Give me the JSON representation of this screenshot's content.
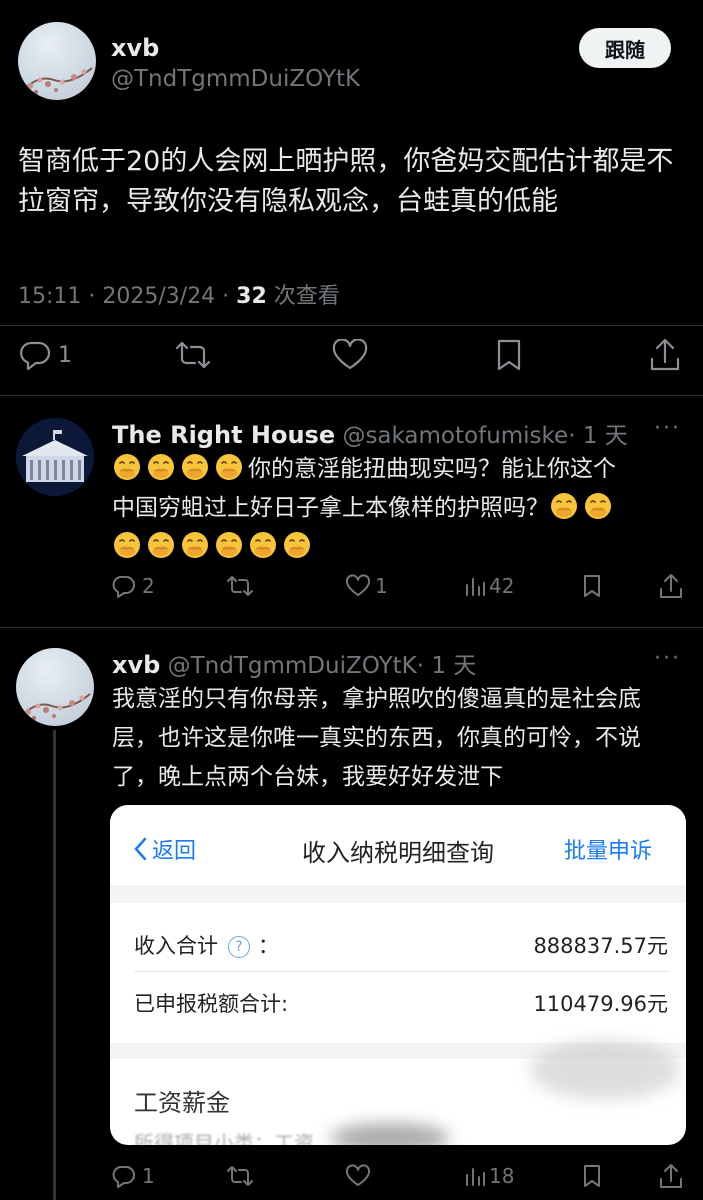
{
  "main_post": {
    "author_name": "xvb",
    "author_handle": "@TndTgmmDuiZOYtK",
    "follow_label": "跟随",
    "text": "智商低于20的人会网上晒护照，你爸妈交配估计都是不拉窗帘，导致你没有隐私观念，台蛙真的低能",
    "time_date": "15:11 · 2025/3/24 · ",
    "views_count": "32",
    "views_label": " 次查看",
    "reply_count": "1"
  },
  "replies": [
    {
      "author_name": "The Right House",
      "author_handle": "@sakamotofumiske",
      "age": "· 1 天",
      "text_line1": "你的意淫能扭曲现实吗？能让你这个",
      "text_line2": "中国穷蛆过上好日子拿上本像样的护照吗？",
      "emoji_desc": "face-with-hand-over-mouth",
      "reply_count": "2",
      "like_count": "1",
      "view_count": "42"
    },
    {
      "author_name": "xvb",
      "author_handle": "@TndTgmmDuiZOYtK",
      "age": "· 1 天",
      "text": "我意淫的只有你母亲，拿护照吹的傻逼真的是社会底层，也许这是你唯一真实的东西，你真的可怜，不说了，晚上点两个台妹，我要好好发泄下",
      "reply_count": "1",
      "view_count": "18",
      "attachment": {
        "back_label": "返回",
        "title": "收入纳税明细查询",
        "action_label": "批量申诉",
        "income_label": "收入合计",
        "income_colon": "：",
        "income_value": "888837.57元",
        "tax_label": "已申报税额合计:",
        "tax_value": "110479.96元",
        "section_title": "工资薪金",
        "sub_label": "所得项目小类：工资"
      }
    }
  ],
  "colors": {
    "background": "#000000",
    "text": "#e7e9ea",
    "muted": "#71767b",
    "link_blue": "#1a7cf0"
  },
  "icons": [
    "reply-icon",
    "retweet-icon",
    "like-icon",
    "bookmark-icon",
    "share-icon",
    "views-icon",
    "more-icon",
    "help-icon",
    "back-chevron-icon"
  ]
}
